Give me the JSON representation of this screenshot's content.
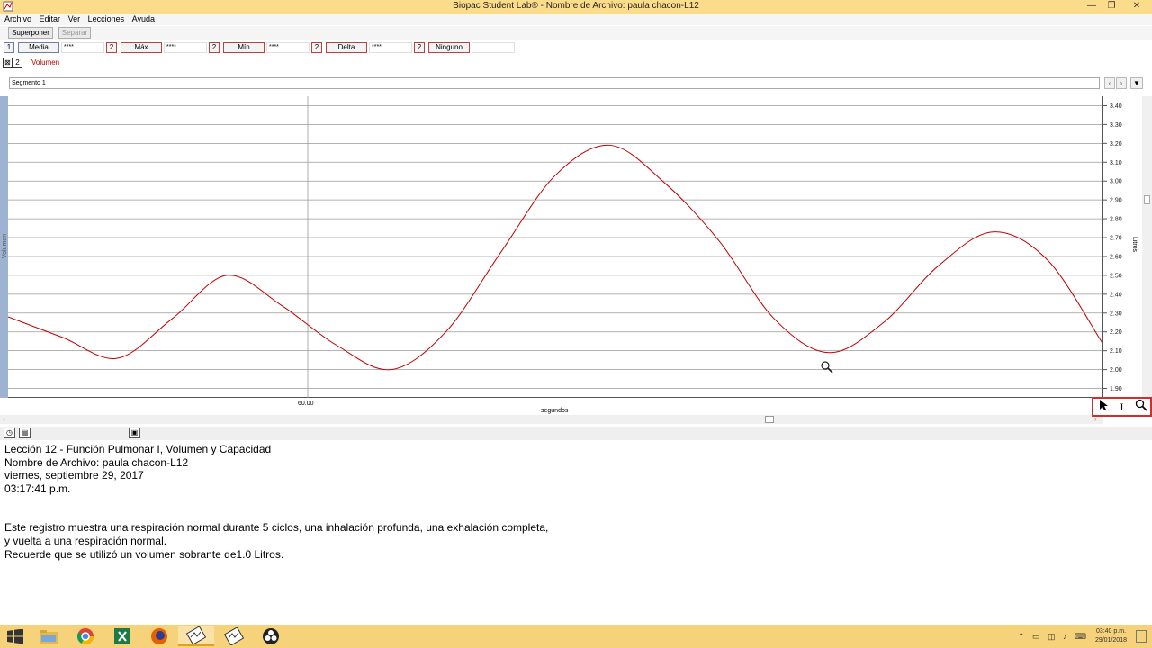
{
  "window": {
    "title": "Biopac Student Lab® - Nombre de Archivo: paula chacon-L12",
    "minimize_label": "—",
    "maximize_label": "❐",
    "close_label": "✕"
  },
  "menu": [
    "Archivo",
    "Editar",
    "Ver",
    "Lecciones",
    "Ayuda"
  ],
  "toolbar": {
    "superponer_label": "Superponer",
    "separar_label": "Separar"
  },
  "measurements": [
    {
      "channel": "1",
      "type": "Media",
      "value": "****"
    },
    {
      "channel": "2",
      "type": "Máx",
      "value": "****"
    },
    {
      "channel": "2",
      "type": "Mín",
      "value": "****"
    },
    {
      "channel": "2",
      "type": "Delta",
      "value": "****"
    },
    {
      "channel": "2",
      "type": "Ninguno",
      "value": ""
    }
  ],
  "channel": {
    "number": "2",
    "name": "Volumen",
    "color": "#c00000"
  },
  "segment": {
    "label": "Segmento 1",
    "prev": "‹",
    "next": "›",
    "dropdown": "▼"
  },
  "plot": {
    "left_axis_label": "Volumen",
    "right_axis_label": "Litros",
    "x_axis_label": "segundos",
    "x_tick": "60.00"
  },
  "chart_data": {
    "type": "line",
    "series": [
      {
        "color": "#c00000",
        "x": [
          0,
          5,
          10,
          15,
          20,
          25,
          30,
          35,
          40,
          45,
          50,
          55,
          60,
          65,
          70,
          75,
          80,
          85,
          90,
          95,
          100
        ],
        "y": [
          2.28,
          2.17,
          2.06,
          2.27,
          2.5,
          2.34,
          2.13,
          2.0,
          2.2,
          2.62,
          3.03,
          3.19,
          2.99,
          2.68,
          2.27,
          2.09,
          2.25,
          2.55,
          2.73,
          2.58,
          2.14
        ]
      }
    ],
    "xlabel": "segundos",
    "ylabel": "Litros",
    "ylim": [
      1.85,
      3.45
    ],
    "yticks": [
      "3.40",
      "3.30",
      "3.20",
      "3.10",
      "3.00",
      "2.90",
      "2.80",
      "2.70",
      "2.60",
      "2.50",
      "2.40",
      "2.30",
      "2.20",
      "2.10",
      "2.00",
      "1.90"
    ],
    "ytick_values": [
      3.4,
      3.3,
      3.2,
      3.1,
      3.0,
      2.9,
      2.8,
      2.7,
      2.6,
      2.5,
      2.4,
      2.3,
      2.2,
      2.1,
      2.0,
      1.9
    ],
    "xticks": [
      "60.00"
    ],
    "grid": true
  },
  "journal": {
    "line1": "Lección 12 - Función Pulmonar I, Volumen y Capacidad",
    "line2": "Nombre de Archivo: paula chacon-L12",
    "line3": "viernes, septiembre 29, 2017",
    "line4": "03:17:41 p.m.",
    "line5": "Este registro muestra una respiración normal durante 5 ciclos, una inhalación profunda, una exhalación completa,",
    "line6": "y vuelta a una respiración normal.",
    "line7": "Recuerde que se utilizó un volumen sobrante de1.0 Litros."
  },
  "taskbar": {
    "time": "03:40 p.m.",
    "date": "29/01/2018"
  }
}
